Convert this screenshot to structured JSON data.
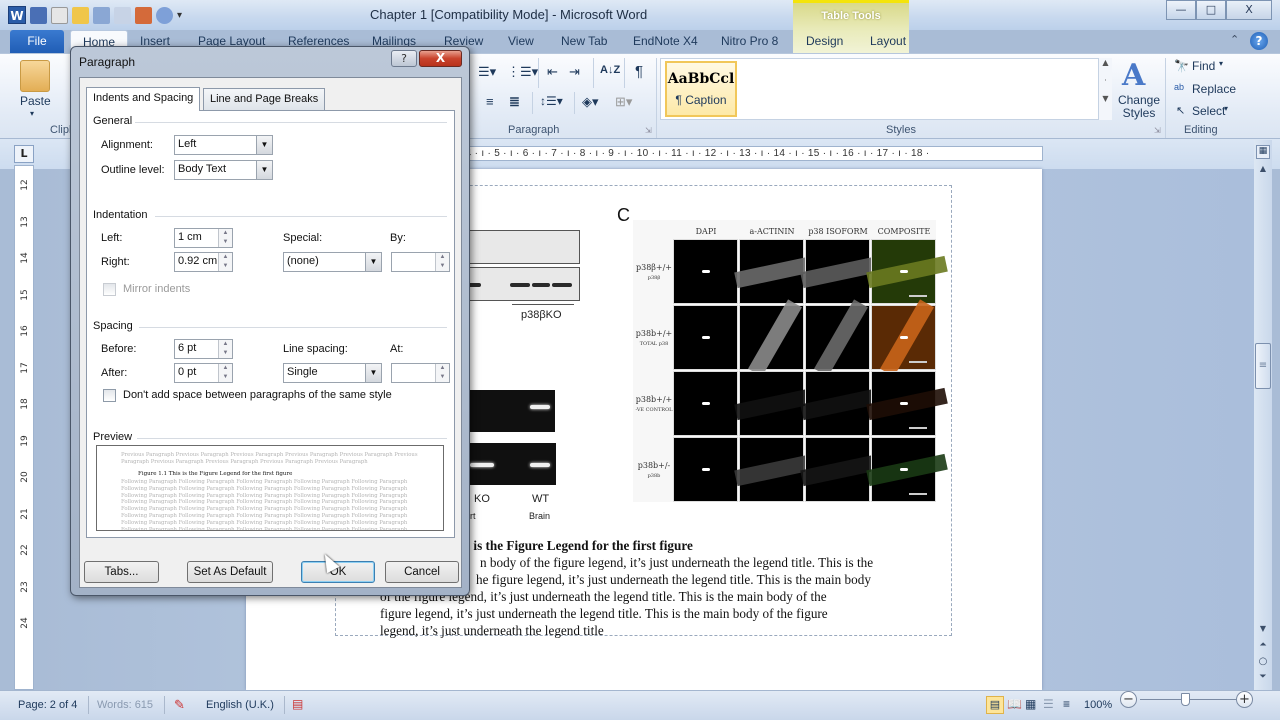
{
  "window": {
    "title": "Chapter 1 [Compatibility Mode]  -  Microsoft Word",
    "app_logo": "W",
    "contextual_tab_group": "Table Tools",
    "controls": {
      "minimize": "—",
      "maximize": "□",
      "close": "X"
    }
  },
  "quick_access": [
    "save-icon",
    "print-preview-icon",
    "open-icon",
    "spelling-icon",
    "attach-icon",
    "nitro-icon",
    "undo-icon",
    "customize-icon"
  ],
  "tabs": [
    {
      "label": "File"
    },
    {
      "label": "Home"
    },
    {
      "label": "Insert"
    },
    {
      "label": "Page Layout"
    },
    {
      "label": "References"
    },
    {
      "label": "Mailings"
    },
    {
      "label": "Review"
    },
    {
      "label": "View"
    },
    {
      "label": "New Tab"
    },
    {
      "label": "EndNote X4"
    },
    {
      "label": "Nitro Pro 8"
    },
    {
      "label": "Design"
    },
    {
      "label": "Layout"
    }
  ],
  "ribbon": {
    "clipboard": {
      "paste_label": "Paste",
      "group_label": "Clipboard"
    },
    "paragraph": {
      "group_label": "Paragraph",
      "sort_glyph": "A↓Z",
      "pilcrow": "¶"
    },
    "styles": {
      "group_label": "Styles",
      "selected_style_sample": "AaBbCcl",
      "selected_style_name": "¶ Caption",
      "change_styles_label": "Change Styles"
    },
    "editing": {
      "group_label": "Editing",
      "find_label": "Find",
      "replace_label": "Replace",
      "select_label": "Select"
    }
  },
  "ruler": {
    "horizontal_ticks": "· 4 · ı · 5 · ı · 6 · ı · 7 · ı · 8 · ı · 9 · ı · 10 · ı · 11 · ı · 12 · ı · 13 · ı · 14 · ı · 15 · ı · 16 · ı · 17 · ı · 18 ·",
    "vertical_ticks": [
      "12",
      "13",
      "14",
      "15",
      "16",
      "17",
      "18",
      "19",
      "20",
      "21",
      "22",
      "23",
      "24"
    ],
    "tab_selector": "L"
  },
  "document": {
    "figure": {
      "panel_label": "C",
      "column_headers": [
        "DAPI",
        "a-ACTININ",
        "p38 ISOFORM",
        "COMPOSITE"
      ],
      "row_labels": [
        {
          "main": "p38β+/+",
          "sub": "p38β"
        },
        {
          "main": "p38b+/+",
          "sub": "TOTAL p38"
        },
        {
          "main": "p38b+/+",
          "sub": "-VE CONTROL"
        },
        {
          "main": "p38b+/-",
          "sub": "p38b"
        }
      ],
      "blot_label": "p38βKO",
      "gel_labels": {
        "ko": "KO",
        "wt": "WT",
        "tissue_partial": "rt",
        "tissue": "Brain"
      }
    },
    "legend": {
      "title_visible": "s is the Figure Legend for the first figure",
      "lines": [
        "n body of the figure legend, it’s just underneath the legend title. This is the",
        "he figure legend, it’s just underneath the legend title. This is the main body",
        "of the figure legend, it’s just underneath the legend title. This is the main body of the",
        "figure legend, it’s just underneath the legend title. This is the main body of the figure",
        "legend, it’s just underneath the legend title"
      ]
    }
  },
  "dialog": {
    "title": "Paragraph",
    "help": "?",
    "close": "X",
    "tabs": [
      "Indents and Spacing",
      "Line and Page Breaks"
    ],
    "general": {
      "section": "General",
      "alignment_label": "Alignment:",
      "alignment_value": "Left",
      "outline_label": "Outline level:",
      "outline_value": "Body Text"
    },
    "indentation": {
      "section": "Indentation",
      "left_label": "Left:",
      "left_value": "1 cm",
      "right_label": "Right:",
      "right_value": "0.92 cm",
      "special_label": "Special:",
      "special_value": "(none)",
      "by_label": "By:",
      "by_value": "",
      "mirror_label": "Mirror indents",
      "mirror_checked": false
    },
    "spacing": {
      "section": "Spacing",
      "before_label": "Before:",
      "before_value": "6 pt",
      "after_label": "After:",
      "after_value": "0 pt",
      "line_spacing_label": "Line spacing:",
      "line_spacing_value": "Single",
      "at_label": "At:",
      "at_value": "",
      "dont_add_label": "Don't add space between paragraphs of the same style",
      "dont_add_checked": false
    },
    "preview": {
      "section": "Preview",
      "previous_text": "Previous Paragraph Previous Paragraph Previous Paragraph Previous Paragraph Previous Paragraph Previous Paragraph Previous Paragraph Previous Paragraph Previous Paragraph Previous Paragraph",
      "main_text": "Figure 1.1 This is the Figure Legend for the first figure",
      "following_text": "Following Paragraph Following Paragraph Following Paragraph Following Paragraph Following Paragraph Following Paragraph Following Paragraph Following Paragraph Following Paragraph Following Paragraph Following Paragraph Following Paragraph Following Paragraph Following Paragraph Following Paragraph Following Paragraph Following Paragraph Following Paragraph Following Paragraph Following Paragraph Following Paragraph Following Paragraph Following Paragraph Following Paragraph Following Paragraph Following Paragraph Following Paragraph Following Paragraph Following Paragraph Following Paragraph Following Paragraph Following Paragraph Following Paragraph Following Paragraph Following Paragraph Following Paragraph Following Paragraph Following Paragraph Following Paragraph Following Paragraph"
    },
    "buttons": {
      "tabs": "Tabs...",
      "set_default": "Set As Default",
      "ok": "OK",
      "cancel": "Cancel"
    }
  },
  "status_bar": {
    "page": "Page: 2 of 4",
    "words": "Words: 615",
    "language": "English (U.K.)",
    "zoom": "100%",
    "zoom_minus": "−",
    "zoom_plus": "+"
  },
  "colors": {
    "ribbon_accent": "#2a5ca8",
    "table_tools": "#d9d98a",
    "style_highlight": "#f1c75a",
    "dialog_close": "#c9432c"
  }
}
